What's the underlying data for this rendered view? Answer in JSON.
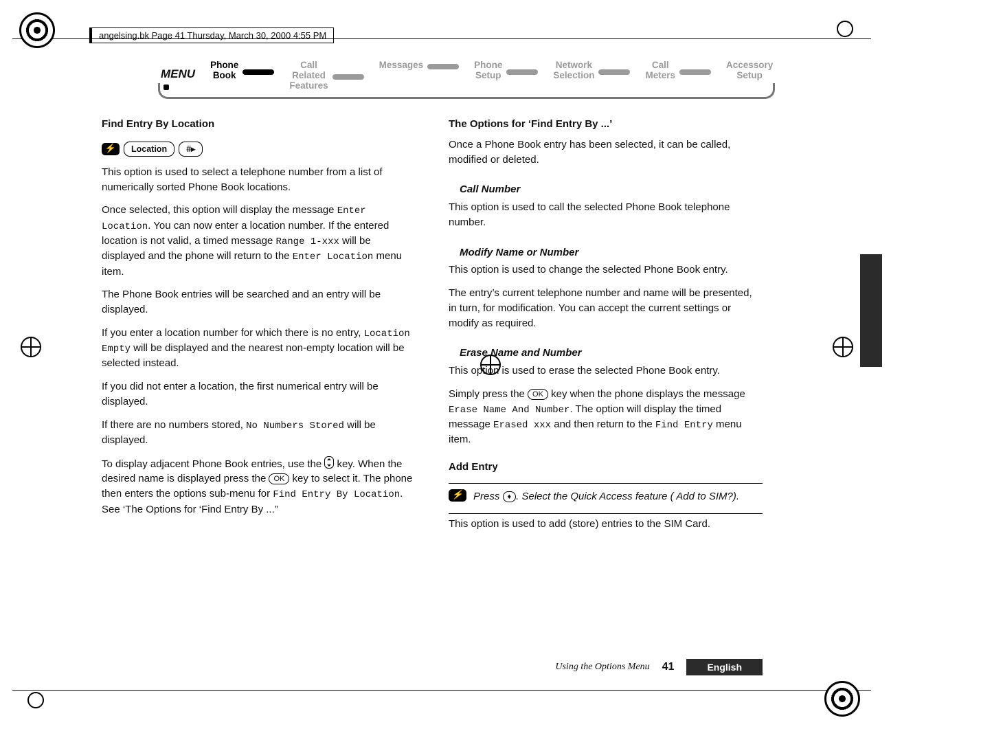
{
  "file_header": "angelsing.bk  Page 41  Thursday, March 30, 2000  4:55 PM",
  "nav": {
    "menu_label": "MENU",
    "items": [
      {
        "line1": "Phone",
        "line2": "Book",
        "active": true
      },
      {
        "line1": "Call Related",
        "line2": "Features",
        "active": false
      },
      {
        "line1": "Messages",
        "line2": "",
        "active": false
      },
      {
        "line1": "Phone",
        "line2": "Setup",
        "active": false
      },
      {
        "line1": "Network",
        "line2": "Selection",
        "active": false
      },
      {
        "line1": "Call",
        "line2": "Meters",
        "active": false
      },
      {
        "line1": "Accessory",
        "line2": "Setup",
        "active": false
      }
    ]
  },
  "left": {
    "h_find_entry_loc": "Find Entry By Location",
    "shortcut": {
      "btn_location": "Location",
      "btn_hash": "#"
    },
    "p1a": "This option is used to select a telephone number from a list of numerically sorted Phone Book locations.",
    "p2a": "Once selected, this option will display the message ",
    "p2_tt1": "Enter Location",
    "p2b": ". You can now enter a location number. If the entered location is not valid, a timed message ",
    "p2_tt2": "Range 1-xxx",
    "p2c": " will be displayed and the phone will return to the ",
    "p2_tt3": "Enter Location",
    "p2d": " menu item.",
    "p3": "The Phone Book entries will be searched and an entry will be displayed.",
    "p4a": "If you enter a location number for which there is no entry, ",
    "p4_tt": "Location Empty",
    "p4b": " will be displayed and the nearest non-empty location will be selected instead.",
    "p5": "If you did not enter a location, the first numerical entry will be displayed.",
    "p6a": "If there are no numbers stored, ",
    "p6_tt": "No Numbers Stored",
    "p6b": " will be displayed.",
    "p7a": "To display adjacent Phone Book entries, use the ",
    "p7b": " key. When the desired name is displayed press the ",
    "p7_ok": "OK",
    "p7c": " key to select it. The phone then enters the options sub-menu for ",
    "p7_tt": "Find Entry By Location",
    "p7d": ". See ‘The Options for ‘Find Entry By ...”"
  },
  "right": {
    "h_options": "The Options for ‘Find Entry By ...’",
    "p_opt": "Once a Phone Book entry has been selected, it can be called, modified or deleted.",
    "h_call": "Call Number",
    "p_call": "This option is used to call the selected Phone Book telephone number.",
    "h_modify": "Modify Name or Number",
    "p_modify1": "This option is used to change the selected Phone Book entry.",
    "p_modify2": "The entry’s current telephone number and name will be presented, in turn, for modification. You can accept the current settings or modify as required.",
    "h_erase": "Erase Name and Number",
    "p_erase1": "This option is used to erase the selected Phone Book entry.",
    "p_erase2a": "Simply press the ",
    "p_erase2_ok": "OK",
    "p_erase2b": " key when the phone displays the message ",
    "p_erase2_tt1": "Erase Name And Number",
    "p_erase2c": ". The option will display the timed message ",
    "p_erase2_tt2": "Erased xxx",
    "p_erase2d": " and then return to the ",
    "p_erase2_tt3": "Find Entry",
    "p_erase2e": " menu item.",
    "h_add": "Add Entry",
    "note_a": "Press ",
    "note_b": ". Select the Quick Access feature ( Add to SIM?).",
    "p_add": "This option is used to add (store) entries to the SIM Card."
  },
  "footer": {
    "section": "Using the Options Menu",
    "page": "41",
    "language": "English"
  }
}
